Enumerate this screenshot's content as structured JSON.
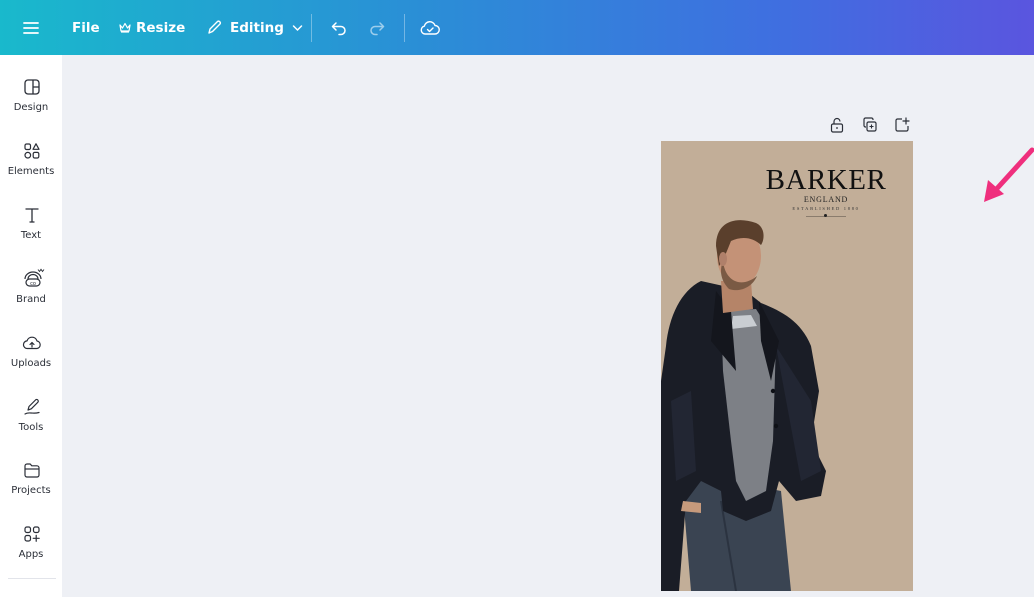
{
  "topbar": {
    "menu_icon": "hamburger-icon",
    "file_label": "File",
    "resize_label": "Resize",
    "resize_icon": "crown-icon",
    "mode_label": "Editing",
    "mode_icon": "pencil-icon",
    "undo_icon": "undo-icon",
    "redo_icon": "redo-icon",
    "save_status_icon": "cloud-check-icon"
  },
  "sidebar": {
    "items": [
      {
        "label": "Design",
        "icon": "design-layout-icon"
      },
      {
        "label": "Elements",
        "icon": "elements-shapes-icon"
      },
      {
        "label": "Text",
        "icon": "text-icon"
      },
      {
        "label": "Brand",
        "icon": "brand-kit-icon"
      },
      {
        "label": "Uploads",
        "icon": "cloud-upload-icon"
      },
      {
        "label": "Tools",
        "icon": "draw-pen-icon"
      },
      {
        "label": "Projects",
        "icon": "folder-icon"
      },
      {
        "label": "Apps",
        "icon": "apps-grid-icon"
      }
    ]
  },
  "canvas": {
    "page_tools": [
      "lock-icon",
      "duplicate-page-icon",
      "add-page-icon"
    ],
    "design": {
      "brand": "BARKER",
      "subtitle": "ENGLAND",
      "established": "ESTABLISHED 1880"
    }
  },
  "colors": {
    "topbar_gradient_start": "#19b9cc",
    "topbar_gradient_end": "#5a55df",
    "page_background": "#c2ae98",
    "workspace": "#eef0f5",
    "arrow": "#ef2f7d"
  }
}
